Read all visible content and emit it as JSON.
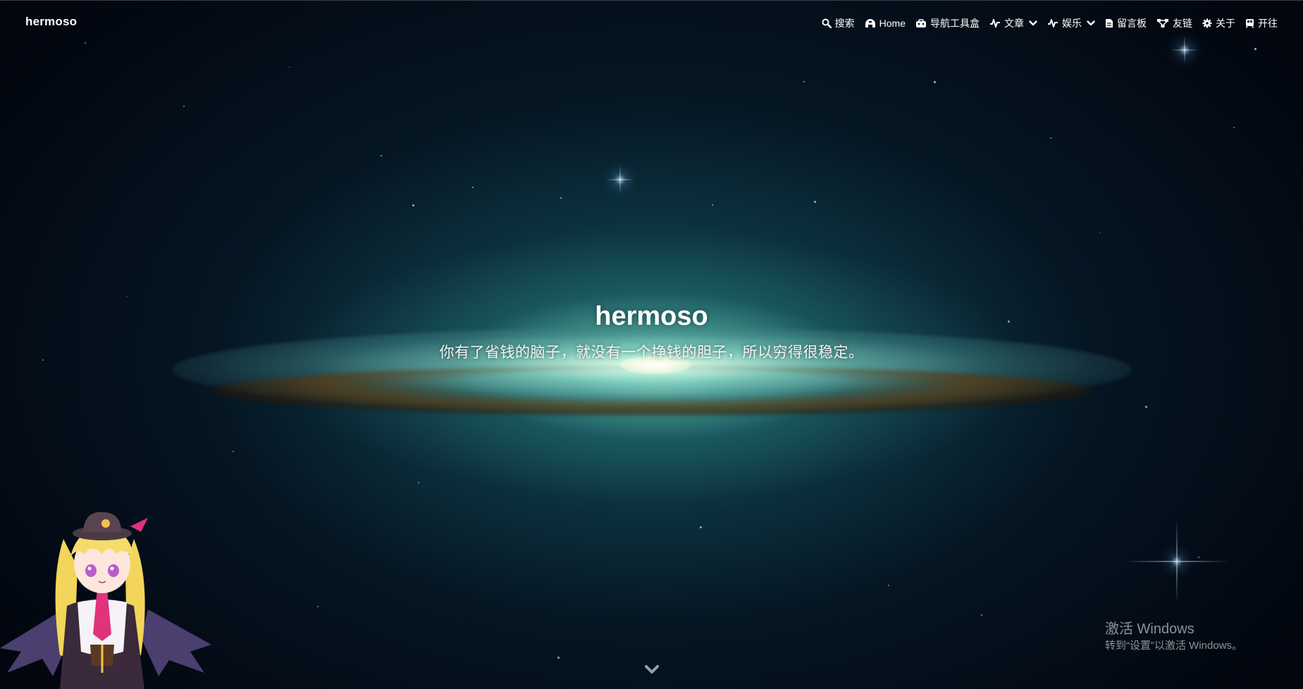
{
  "navbar": {
    "brand": "hermoso",
    "items": [
      {
        "label": "搜索",
        "icon": "search-icon"
      },
      {
        "label": "Home",
        "icon": "home-icon"
      },
      {
        "label": "导航工具盒",
        "icon": "toolbox-icon"
      },
      {
        "label": "文章",
        "icon": "pulse-icon",
        "has_dropdown": true
      },
      {
        "label": "娱乐",
        "icon": "pulse-icon",
        "has_dropdown": true
      },
      {
        "label": "留言板",
        "icon": "document-icon"
      },
      {
        "label": "友链",
        "icon": "network-icon"
      },
      {
        "label": "关于",
        "icon": "gear-icon"
      },
      {
        "label": "开往",
        "icon": "subway-icon"
      }
    ]
  },
  "hero": {
    "title": "hermoso",
    "subtitle": "你有了省钱的脑子，就没有一个挣钱的胆子，所以穷得很稳定。"
  },
  "watermark": {
    "line1": "激活 Windows",
    "line2": "转到“设置”以激活 Windows。"
  },
  "colors": {
    "background": "#02040c",
    "galaxy_glow": "#7fd6c3",
    "text": "#ffffff"
  }
}
